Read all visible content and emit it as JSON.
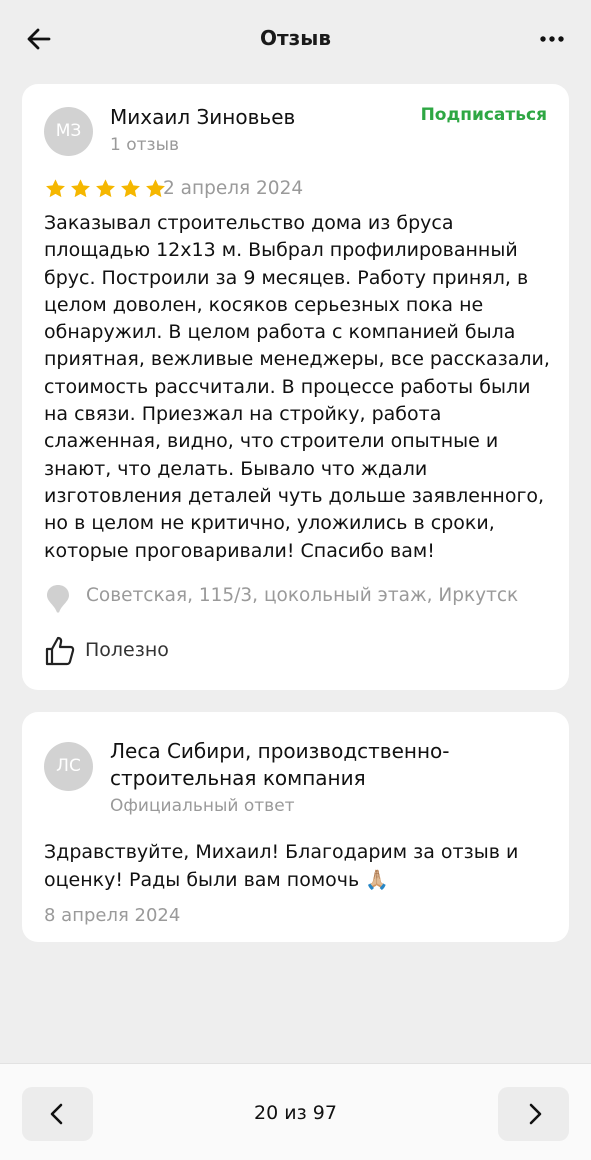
{
  "header": {
    "title": "Отзыв",
    "back_icon": "arrow-left-icon",
    "more_icon": "more-dots-icon"
  },
  "review": {
    "avatar_initials": "МЗ",
    "author": "Михаил Зиновьев",
    "author_stats": "1 отзыв",
    "subscribe_label": "Подписаться",
    "rating": 5,
    "rating_max": 5,
    "date": "2 апреля 2024",
    "text": "Заказывал строительство дома из бруса площадью 12х13 м. Выбрал профилированный брус. Построили за 9 месяцев. Работу принял, в целом доволен, косяков серьезных пока не обнаружил. В целом работа с компанией была приятная, вежливые менеджеры, все рассказали, стоимость рассчитали. В процессе работы были на связи. Приезжал на стройку, работа слаженная, видно, что строители опытные и знают, что делать. Бывало что ждали изготовления деталей чуть дольше заявленного, но в целом не критично, уложились в сроки, которые проговаривали! Спасибо вам!",
    "address": "Советская, 115/3, цокольный этаж, Иркутск",
    "useful_label": "Полезно",
    "address_icon": "map-pin-icon",
    "useful_icon": "thumbs-up-icon"
  },
  "reply": {
    "avatar_initials": "ЛС",
    "author_line1": "Леса Сибири, производственно-",
    "author_line2": "строительная компания",
    "badge": "Официальный ответ",
    "text": "Здравствуйте, Михаил! Благодарим за отзыв и оценку! Рады были вам помочь 🙏🏼",
    "date": "8 апреля 2024"
  },
  "pager": {
    "label": "20 из 97",
    "prev_icon": "chevron-left-icon",
    "next_icon": "chevron-right-icon"
  },
  "colors": {
    "accent_green": "#2ea743",
    "star": "#f5b700",
    "muted": "#9a9a9a",
    "background": "#eeeeee"
  }
}
